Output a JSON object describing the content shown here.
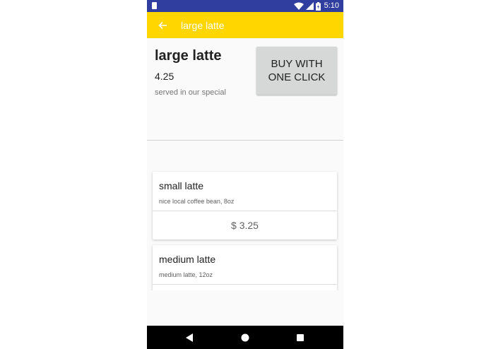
{
  "status_bar": {
    "time": "5:10"
  },
  "app_bar": {
    "title": "large latte"
  },
  "product": {
    "name": "large latte",
    "price": "4.25",
    "description": "served in our special",
    "buy_button_label": "BUY WITH ONE CLICK"
  },
  "list": {
    "items": [
      {
        "name": "small latte",
        "description": "nice local coffee bean, 8oz",
        "price": "$ 3.25"
      },
      {
        "name": "medium latte",
        "description": "medium latte, 12oz",
        "price": ""
      }
    ]
  },
  "colors": {
    "status_bar": "#303f9f",
    "app_bar": "#ffd600",
    "buy_button": "#d6d7d7"
  },
  "icons": [
    "sim-icon",
    "wifi-icon",
    "signal-icon",
    "battery-icon",
    "arrow-back-icon",
    "nav-back-icon",
    "nav-home-icon",
    "nav-recents-icon"
  ]
}
